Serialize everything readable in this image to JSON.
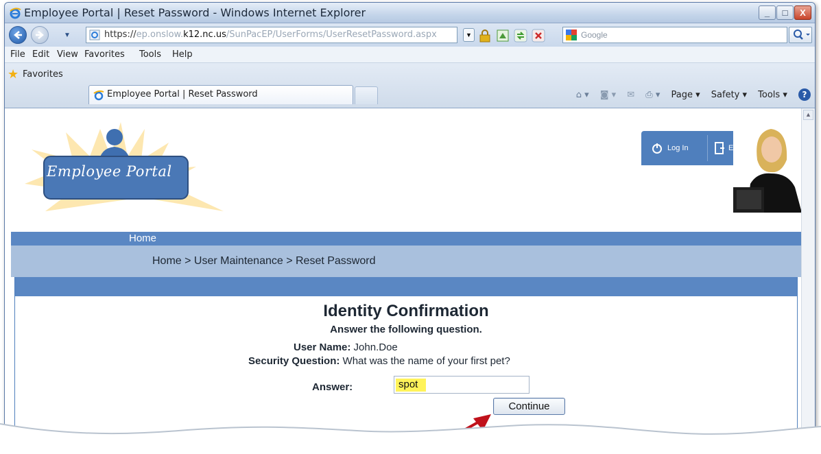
{
  "window": {
    "title": "Employee Portal | Reset Password - Windows Internet Explorer",
    "minimize": "_",
    "maximize": "□",
    "close": "X"
  },
  "address_bar": {
    "url_protocol": "https://",
    "url_subdomain": "ep.onslow.",
    "url_domain": "k12.nc.us",
    "url_path": "/SunPacEP/UserForms/UserResetPassword.aspx",
    "search_placeholder": "Google"
  },
  "menu": [
    "File",
    "Edit",
    "View",
    "Favorites",
    "Tools",
    "Help"
  ],
  "favorites_bar": {
    "favorites_label": "Favorites",
    "active_tab_label": "Employee Portal | Reset Password"
  },
  "command_bar": {
    "page": "Page ▾",
    "safety": "Safety ▾",
    "tools": "Tools ▾"
  },
  "portal": {
    "logo_text": "Employee Portal",
    "login_label": "Log In",
    "exit_label": "Exit",
    "nav_home": "Home",
    "breadcrumb": "Home > User Maintenance > Reset Password"
  },
  "form": {
    "heading": "Identity Confirmation",
    "subheading": "Answer the following question.",
    "user_name_label": "User Name:",
    "user_name_value": "John.Doe",
    "security_question_label": "Security Question:",
    "security_question_value": "What was the name of your first pet?",
    "answer_label": "Answer:",
    "answer_value": "spot",
    "continue_label": "Continue"
  },
  "colors": {
    "nav_blue": "#5a87c3",
    "breadcrumb_blue": "#a9c0dd",
    "highlight_yellow": "#fff35a",
    "arrow_red": "#c0111b"
  }
}
